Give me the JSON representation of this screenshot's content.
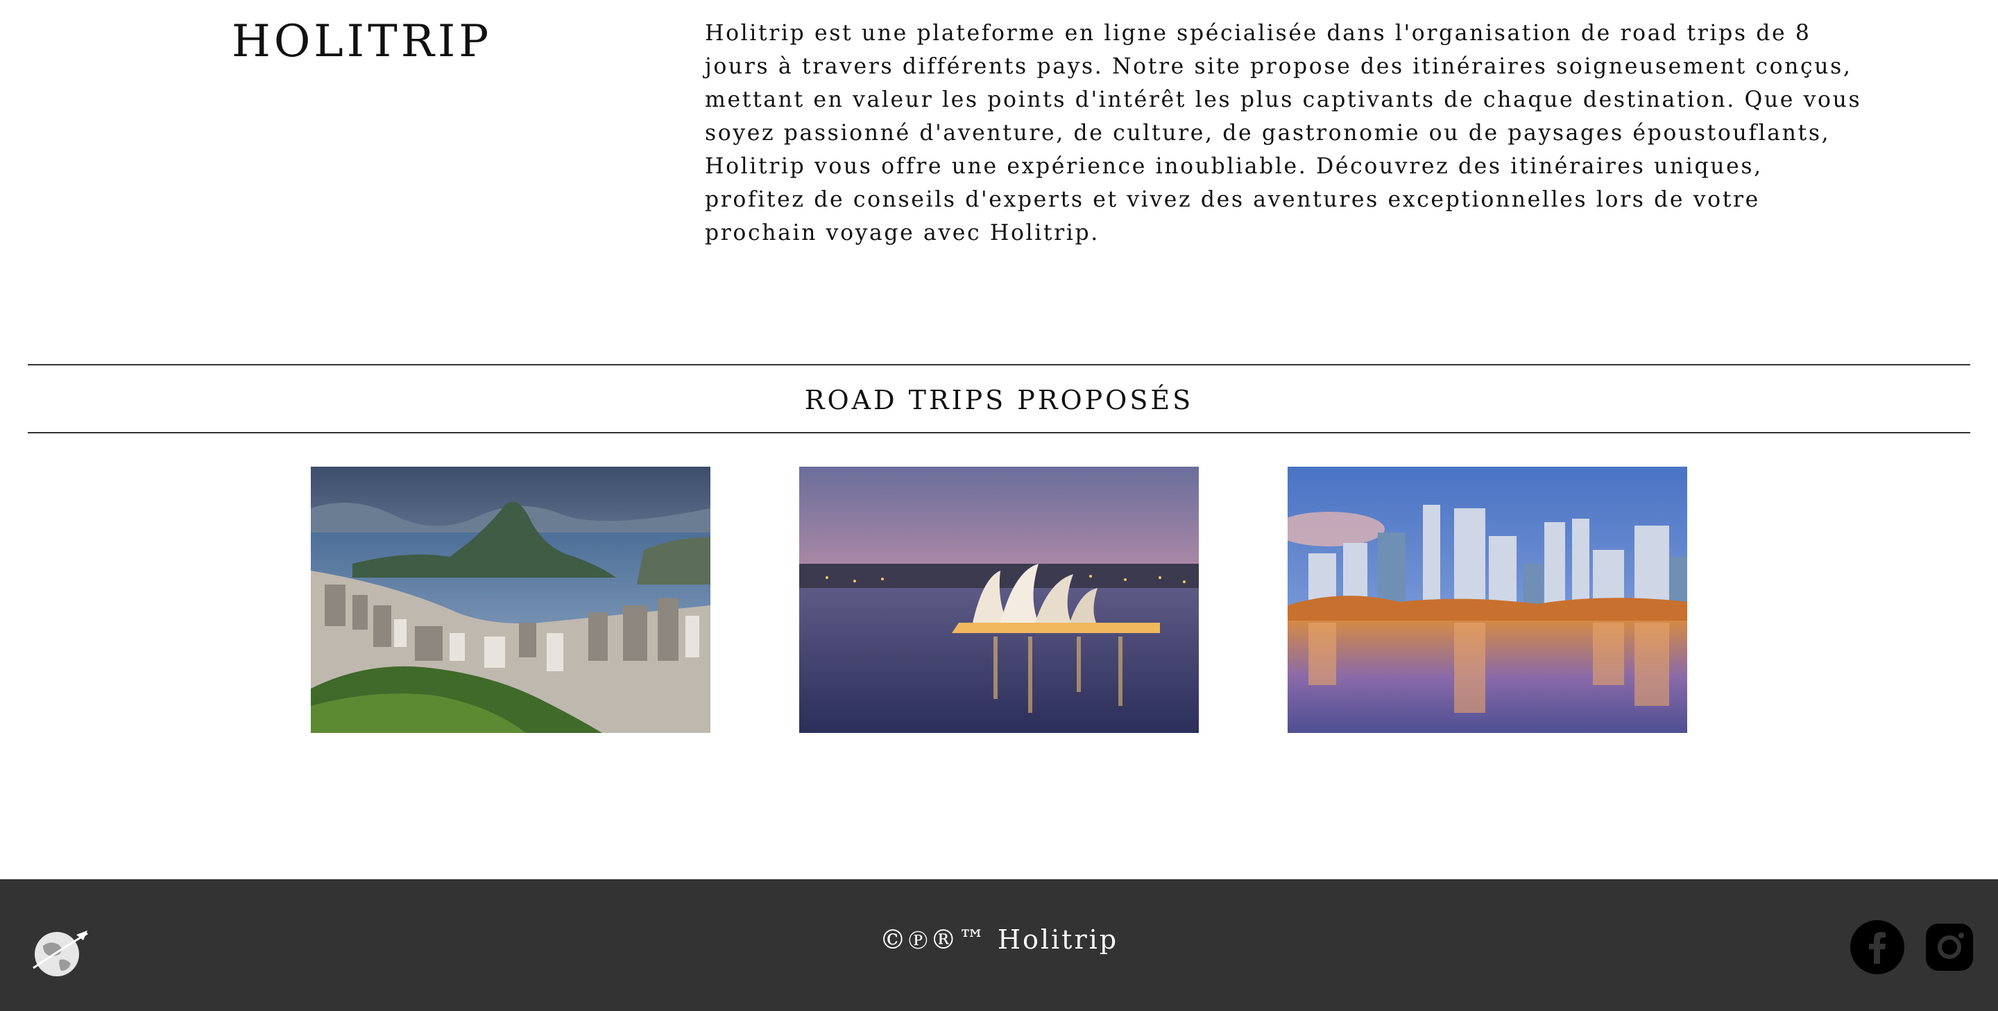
{
  "header": {
    "brand": "HOLITRIP",
    "intro": "Holitrip est une plateforme en ligne spécialisée dans l'organisation de road trips de 8 jours à travers différents pays. Notre site propose des itinéraires soigneusement conçus, mettant en valeur les points d'intérêt les plus captivants de chaque destination. Que vous soyez passionné d'aventure, de culture, de gastronomie ou de paysages époustouflants, Holitrip vous offre une expérience inoubliable. Découvrez des itinéraires uniques, profitez de conseils d'experts et vivez des aventures exceptionnelles lors de votre prochain voyage avec Holitrip."
  },
  "section": {
    "title": "ROAD TRIPS PROPOSÉS"
  },
  "footer": {
    "copyright": "©℗®™ Holitrip",
    "logo_icon": "globe-plane-icon",
    "social": [
      {
        "icon": "facebook-icon"
      },
      {
        "icon": "instagram-icon"
      }
    ]
  },
  "colors": {
    "footer_bg": "#333333",
    "rule": "#333333",
    "text": "#111111"
  }
}
